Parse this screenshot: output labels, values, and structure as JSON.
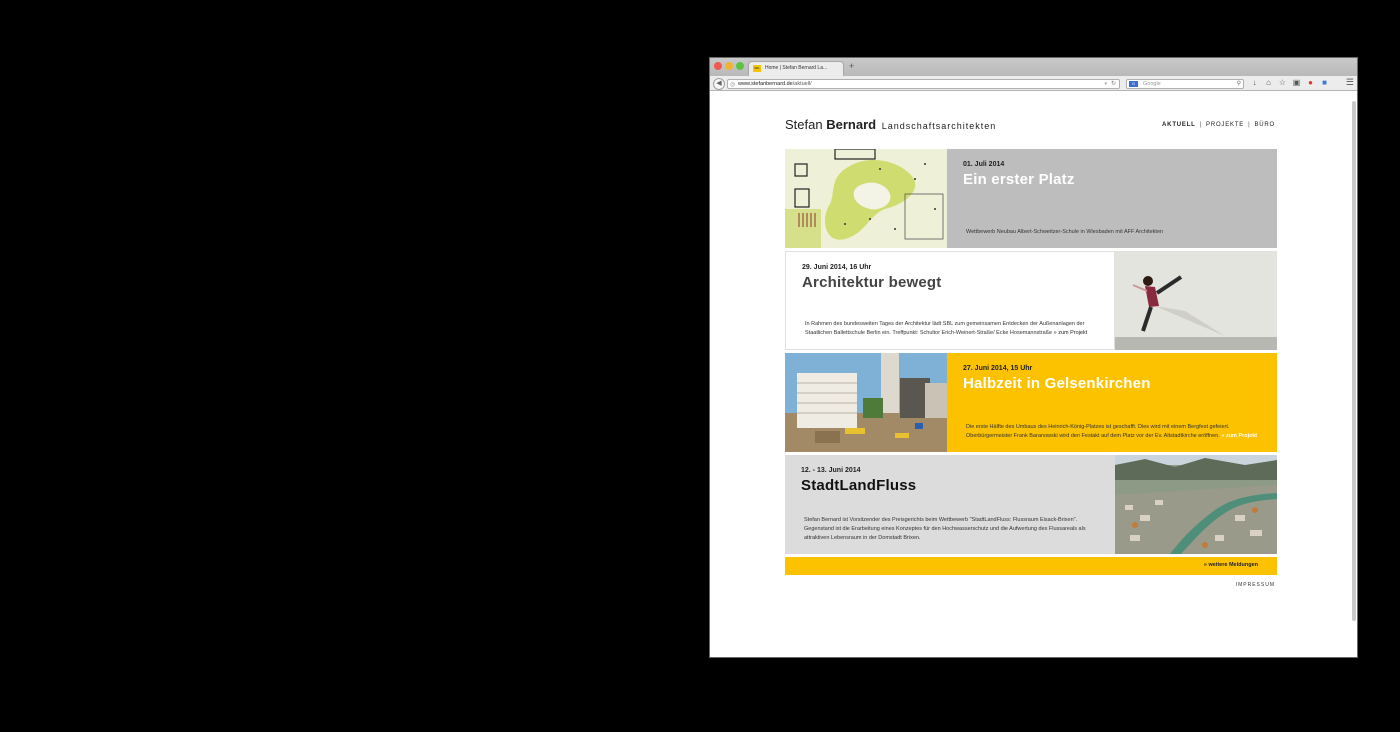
{
  "browser": {
    "tab_title": "Home | Stefan Bernard La...",
    "favicon_text": "SBL",
    "new_tab": "+",
    "url_domain": "www.stefanbernard.de",
    "url_path": "/aktuell/",
    "search_placeholder": "Google",
    "search_engine": "G"
  },
  "site": {
    "logo_first": "Stefan",
    "logo_second": "Bernard",
    "logo_sub": "Landschaftsarchitekten",
    "nav": {
      "aktuell": "AKTUELL",
      "projekte": "PROJEKTE",
      "buero": "BÜRO",
      "separator": "|"
    }
  },
  "news": [
    {
      "date": "01. Juli 2014",
      "title": "Ein erster Platz",
      "description": "Wettbewerb Neubau Albert-Schweitzer-Schule in Wiesbaden mit AFF Architekten",
      "link": ""
    },
    {
      "date": "29. Juni 2014, 16 Uhr",
      "title": "Architektur bewegt",
      "description": "In Rahmen des bundesweiten Tages der Architektur lädt SBL zum gemeinsamen Entdecken der Außenanlagen der Staatlichen Ballettschule Berlin ein. Treffpunkt: Schultor Erich-Weinert-Straße/ Ecke Hosemannstraße",
      "link": "» zum Projekt"
    },
    {
      "date": "27. Juni 2014, 15 Uhr",
      "title": "Halbzeit in Gelsenkirchen",
      "description": "Die erste Hälfte des Umbaus des Heinrich-König-Platzes ist geschafft. Dies wird mit einem Bergfest gefeiert. Oberbürgermeister Frank Baranowski wird den Festakt auf dem Platz vor der Ev. Altstadtkirche eröffnen.",
      "link": "» zum Projekt"
    },
    {
      "date": "12. - 13. Juni 2014",
      "title": "StadtLandFluss",
      "description": "Stefan Bernard ist Vorsitzender des Preisgerichts beim Wettbewerb \"StadtLandFluss: Flussraum Eisack-Brixen\". Gegenstand ist die Erarbeitung eines Konzeptes für den Hochwasserschutz und die Aufwertung des Flussareals als attraktiven Lebensraum in der Domstadt Brixen.",
      "link": ""
    }
  ],
  "more_news": "» weitere Meldungen",
  "impressum": "IMPRESSUM",
  "colors": {
    "yellow": "#fcc200",
    "grey": "#bdbdbd",
    "lightgrey": "#dcdcdc"
  }
}
